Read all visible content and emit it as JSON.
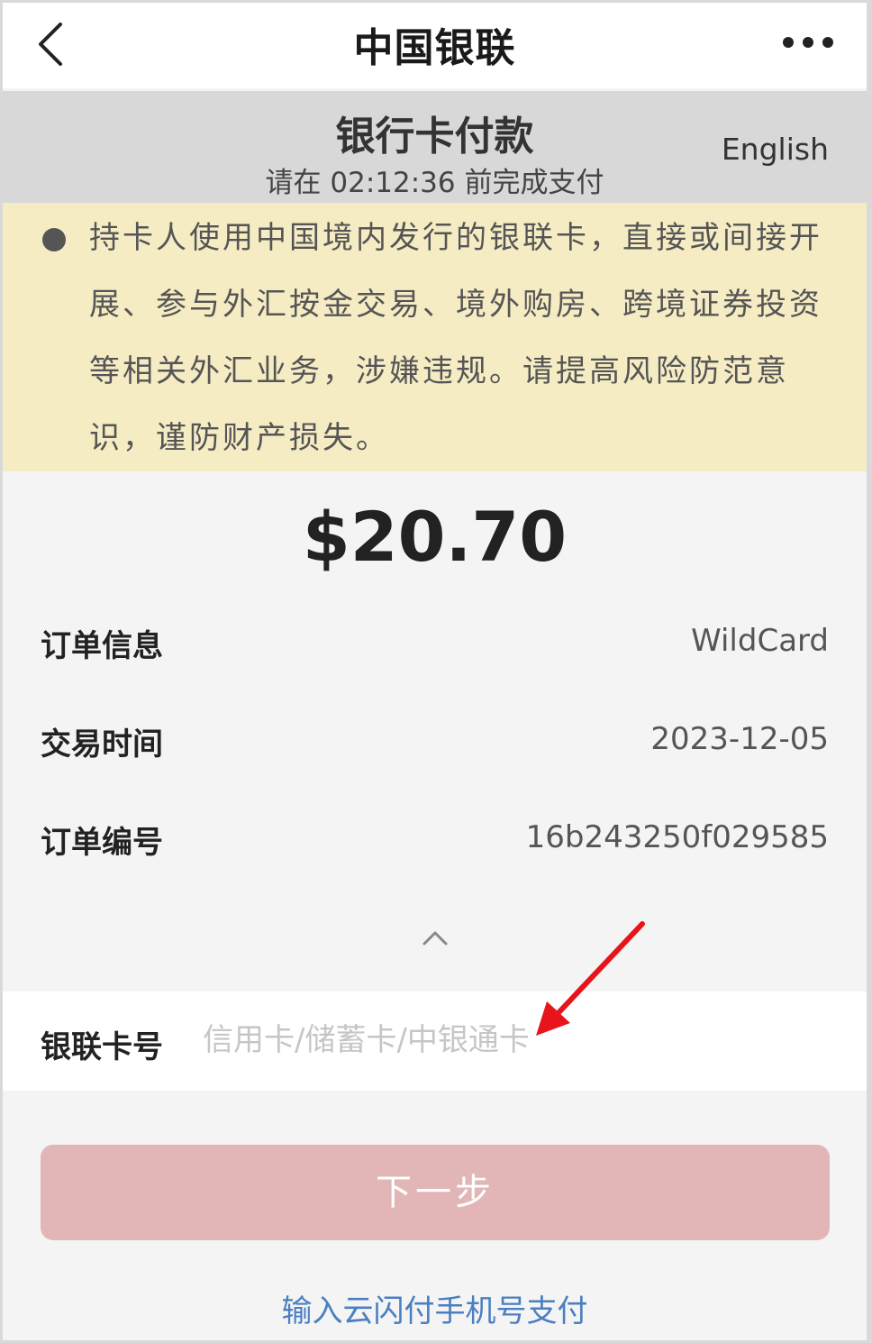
{
  "navbar": {
    "title": "中国银联"
  },
  "header": {
    "page_title": "银行卡付款",
    "countdown": "请在 02:12:36 前完成支付",
    "language_link": "English"
  },
  "notice": {
    "text": "持卡人使用中国境内发行的银联卡，直接或间接开展、参与外汇按金交易、境外购房、跨境证券投资等相关外汇业务，涉嫌违规。请提高风险防范意识，谨防财产损失。"
  },
  "payment": {
    "amount": "$20.70"
  },
  "order_info": {
    "rows": [
      {
        "label": "订单信息",
        "value": "WildCard"
      },
      {
        "label": "交易时间",
        "value": "2023-12-05"
      },
      {
        "label": "订单编号",
        "value": "16b243250f029585"
      }
    ]
  },
  "card_input": {
    "label": "银联卡号",
    "placeholder": "信用卡/储蓄卡/中银通卡",
    "value": ""
  },
  "actions": {
    "next_label": "下一步",
    "alt_pay_label": "输入云闪付手机号支付"
  },
  "icons": {
    "back": "chevron-left-icon",
    "more": "more-dots-icon",
    "collapse": "chevron-up-icon",
    "annotation": "red-arrow-icon"
  },
  "colors": {
    "notice_bg": "#f6ecc4",
    "button_bg": "#e2b6b7",
    "link": "#4a7fc1",
    "annotation": "#e8141b"
  }
}
